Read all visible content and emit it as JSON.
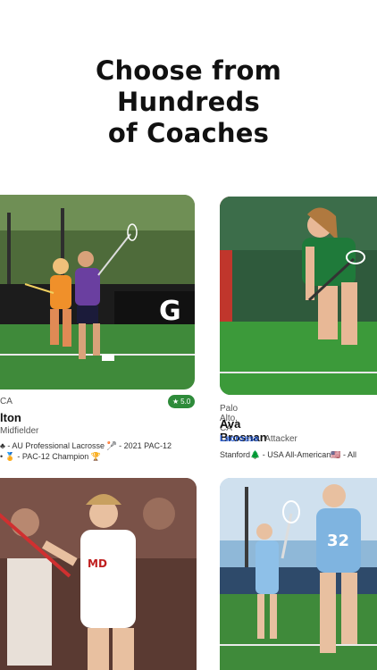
{
  "headline": {
    "line1": "Choose from",
    "line2": "Hundreds",
    "line3": "of Coaches"
  },
  "coaches": [
    {
      "location": "CA",
      "name": "lton",
      "position": "Midfielder",
      "rating": "5.0",
      "bio_line1": "♣ - AU Professional Lacrosse 🥍 - 2021 PAC-12",
      "bio_line2": "• 🏅 - PAC-12 Champion 🏆"
    },
    {
      "location": "Palo Alto, CA",
      "name": "Ava Brosnan",
      "sport": "Lacrosse",
      "position": "Attacker",
      "bio_line1": "Stanford🌲 - USA All-American🇺🇸 - All"
    }
  ],
  "colors": {
    "accent_blue": "#2a5fd6",
    "rating_green": "#2e8b3a"
  }
}
